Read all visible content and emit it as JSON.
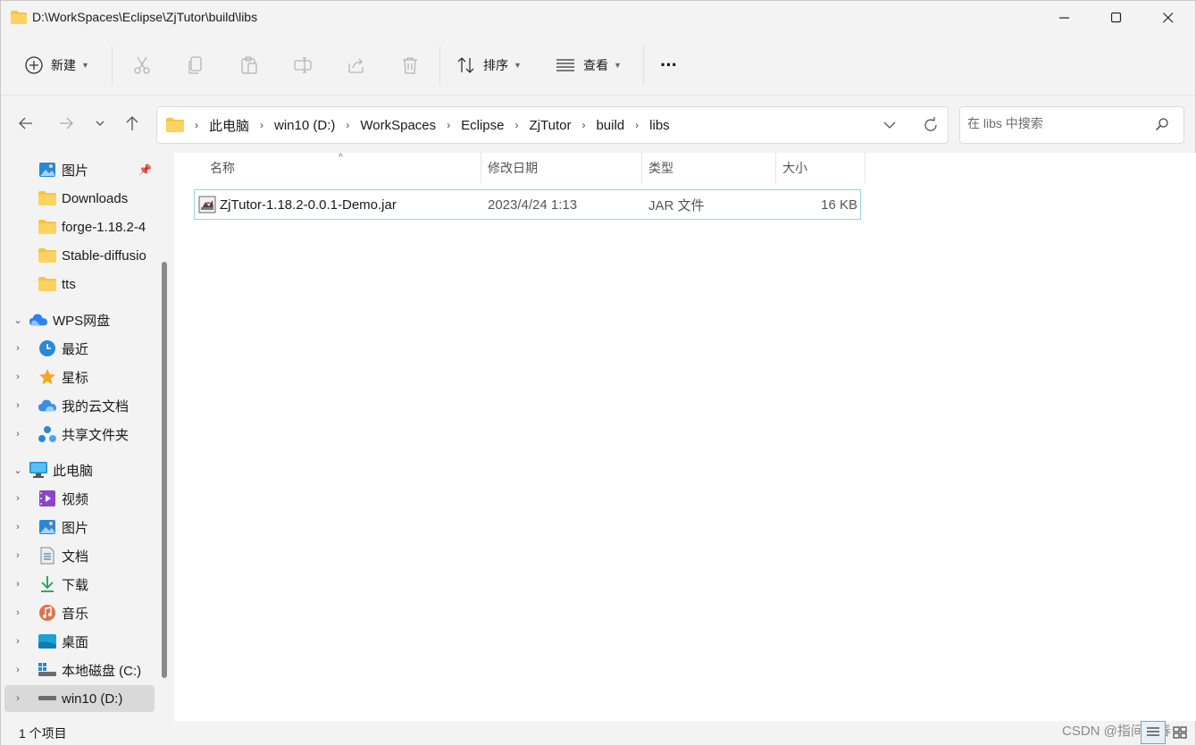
{
  "window": {
    "title": "D:\\WorkSpaces\\Eclipse\\ZjTutor\\build\\libs"
  },
  "toolbar": {
    "new_label": "新建",
    "sort_label": "排序",
    "view_label": "查看",
    "more_label": "···"
  },
  "address": {
    "crumbs": [
      "此电脑",
      "win10 (D:)",
      "WorkSpaces",
      "Eclipse",
      "ZjTutor",
      "build",
      "libs"
    ]
  },
  "search": {
    "placeholder": "在 libs 中搜索"
  },
  "sidebar": {
    "items": [
      {
        "label": "图片",
        "icon": "pictures-icon"
      },
      {
        "label": "Downloads",
        "icon": "folder-icon"
      },
      {
        "label": "forge-1.18.2-4",
        "icon": "folder-icon"
      },
      {
        "label": "Stable-diffusio",
        "icon": "folder-icon"
      },
      {
        "label": "tts",
        "icon": "folder-icon"
      },
      {
        "label": "WPS网盘",
        "icon": "wps-cloud-icon"
      },
      {
        "label": "最近",
        "icon": "recent-icon"
      },
      {
        "label": "星标",
        "icon": "star-icon"
      },
      {
        "label": "我的云文档",
        "icon": "cloud-doc-icon"
      },
      {
        "label": "共享文件夹",
        "icon": "shared-folder-icon"
      },
      {
        "label": "此电脑",
        "icon": "this-pc-icon"
      },
      {
        "label": "视频",
        "icon": "videos-icon"
      },
      {
        "label": "图片",
        "icon": "pictures-icon"
      },
      {
        "label": "文档",
        "icon": "documents-icon"
      },
      {
        "label": "下载",
        "icon": "downloads-icon"
      },
      {
        "label": "音乐",
        "icon": "music-icon"
      },
      {
        "label": "桌面",
        "icon": "desktop-icon"
      },
      {
        "label": "本地磁盘 (C:)",
        "icon": "drive-icon"
      },
      {
        "label": "win10 (D:)",
        "icon": "drive-icon"
      }
    ]
  },
  "columns": {
    "name": "名称",
    "modified": "修改日期",
    "type": "类型",
    "size": "大小"
  },
  "files": [
    {
      "name": "ZjTutor-1.18.2-0.0.1-Demo.jar",
      "modified": "2023/4/24 1:13",
      "type": "JAR 文件",
      "size": "16 KB"
    }
  ],
  "status": {
    "count": "1 个项目"
  },
  "watermark": "CSDN @指间青春",
  "colors": {
    "accent": "#0067c0",
    "selection_border": "#99d1e3",
    "folder": "#f8c43a"
  }
}
